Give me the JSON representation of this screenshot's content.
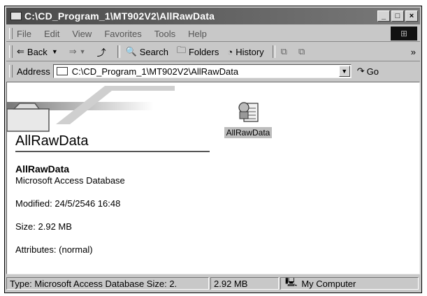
{
  "window": {
    "title": "C:\\CD_Program_1\\MT902V2\\AllRawData"
  },
  "window_buttons": {
    "minimize": "_",
    "maximize": "□",
    "close": "×"
  },
  "menu": [
    "File",
    "Edit",
    "View",
    "Favorites",
    "Tools",
    "Help"
  ],
  "toolbar": {
    "back": "Back",
    "search": "Search",
    "folders": "Folders",
    "history": "History",
    "more": "»"
  },
  "address": {
    "label": "Address",
    "value": "C:\\CD_Program_1\\MT902V2\\AllRawData",
    "go": "Go"
  },
  "details": {
    "folder_title": "AllRawData",
    "name": "AllRawData",
    "type": "Microsoft Access Database",
    "modified": "Modified: 24/5/2546 16:48",
    "size": "Size: 2.92 MB",
    "attributes": "Attributes: (normal)"
  },
  "file": {
    "label": "AllRawData",
    "icon": "access-database-icon"
  },
  "status": {
    "type_text": "Type: Microsoft Access Database Size: 2.",
    "size": "2.92 MB",
    "zone": "My Computer"
  }
}
